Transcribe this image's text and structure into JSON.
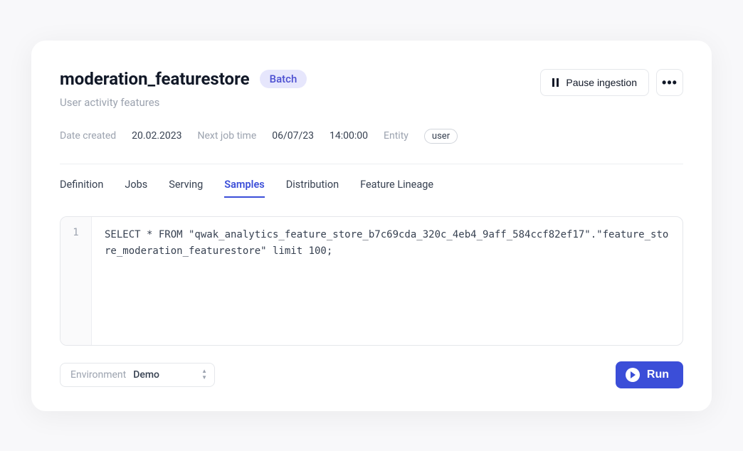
{
  "header": {
    "title": "moderation_featurestore",
    "badge": "Batch",
    "subtitle": "User activity features",
    "pause_button": "Pause ingestion"
  },
  "meta": {
    "date_created_label": "Date created",
    "date_created_value": "20.02.2023",
    "next_job_label": "Next job time",
    "next_job_date": "06/07/23",
    "next_job_time": "14:00:00",
    "entity_label": "Entity",
    "entity_value": "user"
  },
  "tabs": {
    "items": [
      {
        "label": "Definition",
        "active": false
      },
      {
        "label": "Jobs",
        "active": false
      },
      {
        "label": "Serving",
        "active": false
      },
      {
        "label": "Samples",
        "active": true
      },
      {
        "label": "Distribution",
        "active": false
      },
      {
        "label": "Feature Lineage",
        "active": false
      }
    ]
  },
  "editor": {
    "line_number": "1",
    "sql": "SELECT * FROM \"qwak_analytics_feature_store_b7c69cda_320c_4eb4_9aff_584ccf82ef17\".\"feature_store_moderation_featurestore\" limit 100;"
  },
  "footer": {
    "env_label": "Environment",
    "env_value": "Demo",
    "run_label": "Run"
  }
}
